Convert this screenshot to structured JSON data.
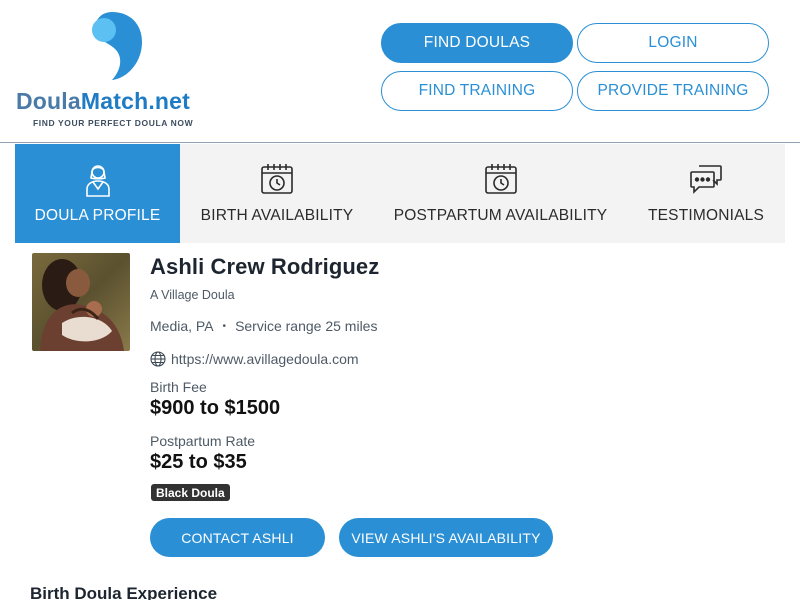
{
  "brand": {
    "name_part1": "Doula",
    "name_part2": "Match.net",
    "tagline": "FIND YOUR PERFECT DOULA NOW",
    "color_primary": "#2a8fd4",
    "color_light": "#5cc0f2"
  },
  "nav": {
    "find_doulas": "FIND DOULAS",
    "login": "LOGIN",
    "find_training": "FIND TRAINING",
    "provide_training": "PROVIDE TRAINING"
  },
  "tabs": [
    {
      "label": "DOULA PROFILE",
      "icon": "doula-person-icon",
      "active": true
    },
    {
      "label": "BIRTH AVAILABILITY",
      "icon": "calendar-clock-icon",
      "active": false
    },
    {
      "label": "POSTPARTUM AVAILABILITY",
      "icon": "calendar-clock-icon",
      "active": false
    },
    {
      "label": "TESTIMONIALS",
      "icon": "chat-bubbles-icon",
      "active": false
    }
  ],
  "profile": {
    "name": "Ashli Crew Rodriguez",
    "business": "A Village Doula",
    "location": "Media, PA",
    "separator": "•",
    "service_range": "Service range 25 miles",
    "website": "https://www.avillagedoula.com",
    "birth_fee_label": "Birth Fee",
    "birth_fee": "$900 to $1500",
    "postpartum_rate_label": "Postpartum Rate",
    "postpartum_rate": "$25 to $35",
    "badge": "Black Doula"
  },
  "actions": {
    "contact": "CONTACT ASHLI",
    "availability": "VIEW ASHLI'S AVAILABILITY"
  },
  "section": {
    "title": "Birth Doula Experience"
  }
}
